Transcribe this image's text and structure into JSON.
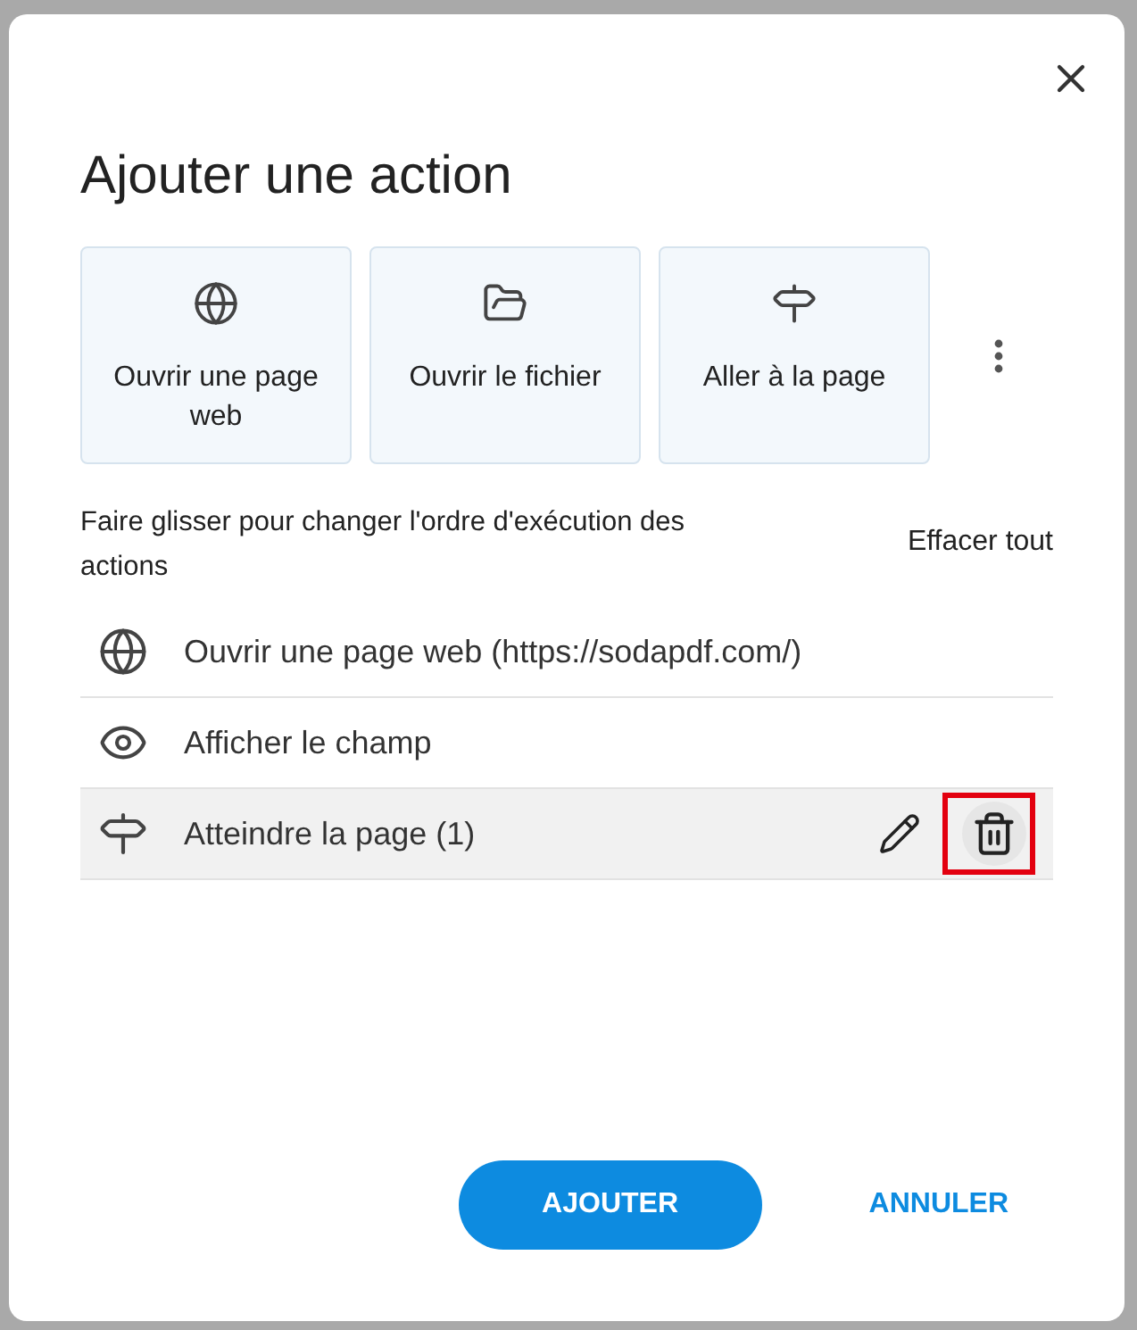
{
  "dialog": {
    "title": "Ajouter une action",
    "action_types": [
      {
        "kind": "web",
        "label": "Ouvrir une page web"
      },
      {
        "kind": "file",
        "label": "Ouvrir le fichier"
      },
      {
        "kind": "page",
        "label": "Aller à la page"
      }
    ],
    "hint": "Faire glisser pour changer l'ordre d'exécution des actions",
    "clear_all": "Effacer tout",
    "actions": [
      {
        "kind": "web",
        "label": "Ouvrir une page web (https://sodapdf.com/)",
        "selected": false
      },
      {
        "kind": "show",
        "label": "Afficher le champ",
        "selected": false
      },
      {
        "kind": "page",
        "label": "Atteindre la page (1)",
        "selected": true,
        "delete_highlighted": true
      }
    ],
    "buttons": [
      {
        "kind": "primary",
        "label": "AJOUTER"
      },
      {
        "kind": "text",
        "label": "ANNULER"
      }
    ]
  }
}
